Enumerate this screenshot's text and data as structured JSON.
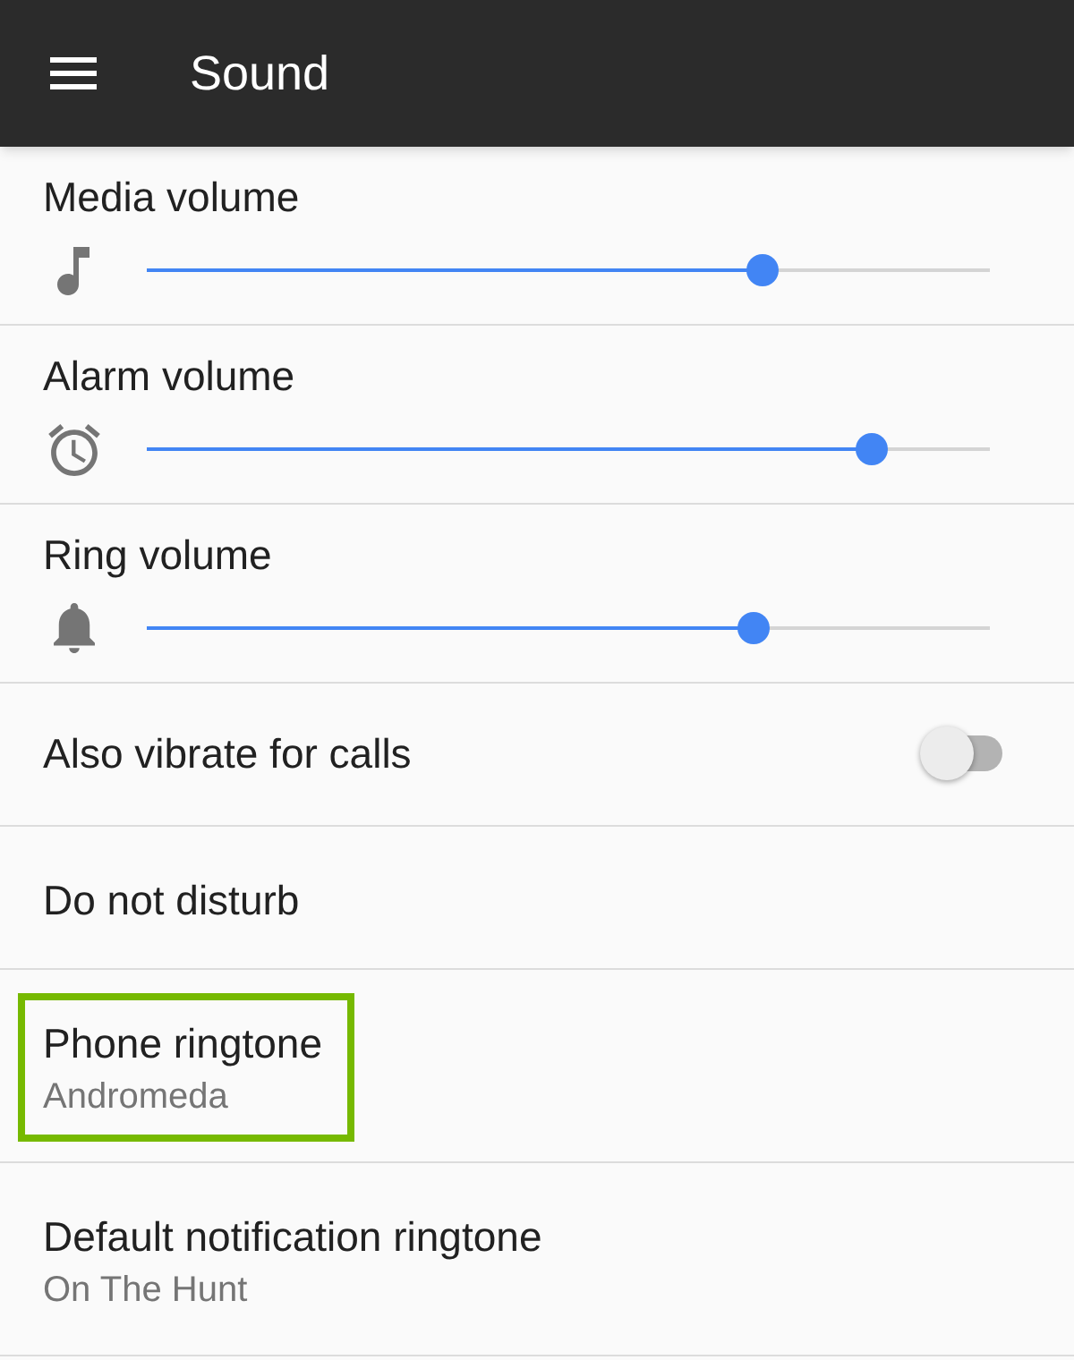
{
  "app_bar": {
    "title": "Sound"
  },
  "settings": [
    {
      "kind": "slider",
      "label": "Media volume",
      "level": 0.73,
      "highlighted": false
    },
    {
      "kind": "slider",
      "label": "Alarm volume",
      "level": 0.86,
      "highlighted": false
    },
    {
      "kind": "slider",
      "label": "Ring volume",
      "level": 0.72,
      "highlighted": false
    },
    {
      "kind": "switch",
      "label": "Also vibrate for calls",
      "on": false,
      "highlighted": false
    },
    {
      "kind": "item",
      "label": "Do not disturb",
      "highlighted": false
    },
    {
      "kind": "item",
      "label": "Phone ringtone",
      "summary": "Andromeda",
      "highlighted": true
    },
    {
      "kind": "item",
      "label": "Default notification ringtone",
      "summary": "On The Hunt",
      "highlighted": false
    }
  ]
}
